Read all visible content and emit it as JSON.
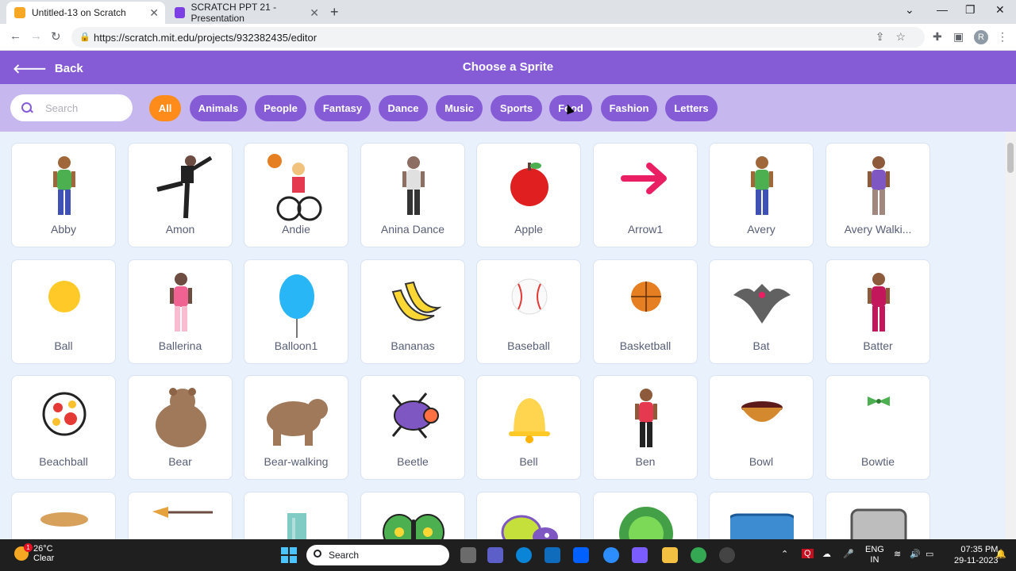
{
  "browser": {
    "tabs": [
      {
        "title": "Untitled-13 on Scratch",
        "active": true
      },
      {
        "title": "SCRATCH PPT 21 - Presentation",
        "active": false
      }
    ],
    "url": "https://scratch.mit.edu/projects/932382435/editor",
    "profile_initial": "R"
  },
  "header": {
    "back_label": "Back",
    "title": "Choose a Sprite"
  },
  "search": {
    "placeholder": "Search"
  },
  "filters": [
    {
      "label": "All",
      "active": true
    },
    {
      "label": "Animals",
      "active": false
    },
    {
      "label": "People",
      "active": false
    },
    {
      "label": "Fantasy",
      "active": false
    },
    {
      "label": "Dance",
      "active": false
    },
    {
      "label": "Music",
      "active": false
    },
    {
      "label": "Sports",
      "active": false
    },
    {
      "label": "Food",
      "active": false
    },
    {
      "label": "Fashion",
      "active": false
    },
    {
      "label": "Letters",
      "active": false
    }
  ],
  "sprites": [
    {
      "name": "Abby",
      "icon": "girl-standing"
    },
    {
      "name": "Amon",
      "icon": "man-balancing"
    },
    {
      "name": "Andie",
      "icon": "wheelchair-basketball"
    },
    {
      "name": "Anina Dance",
      "icon": "woman-dancing"
    },
    {
      "name": "Apple",
      "icon": "apple"
    },
    {
      "name": "Arrow1",
      "icon": "arrow"
    },
    {
      "name": "Avery",
      "icon": "girl-standing"
    },
    {
      "name": "Avery Walki...",
      "icon": "girl-walking"
    },
    {
      "name": "Ball",
      "icon": "ball"
    },
    {
      "name": "Ballerina",
      "icon": "ballerina"
    },
    {
      "name": "Balloon1",
      "icon": "balloon"
    },
    {
      "name": "Bananas",
      "icon": "bananas"
    },
    {
      "name": "Baseball",
      "icon": "baseball"
    },
    {
      "name": "Basketball",
      "icon": "basketball"
    },
    {
      "name": "Bat",
      "icon": "bat"
    },
    {
      "name": "Batter",
      "icon": "batter"
    },
    {
      "name": "Beachball",
      "icon": "beachball"
    },
    {
      "name": "Bear",
      "icon": "bear"
    },
    {
      "name": "Bear-walking",
      "icon": "bear-walking"
    },
    {
      "name": "Beetle",
      "icon": "beetle"
    },
    {
      "name": "Bell",
      "icon": "bell"
    },
    {
      "name": "Ben",
      "icon": "boy-running"
    },
    {
      "name": "Bowl",
      "icon": "bowl"
    },
    {
      "name": "Bowtie",
      "icon": "bowtie"
    },
    {
      "name": "",
      "icon": "bread"
    },
    {
      "name": "",
      "icon": "broom"
    },
    {
      "name": "",
      "icon": "building"
    },
    {
      "name": "",
      "icon": "butterfly"
    },
    {
      "name": "",
      "icon": "butterfly-creature"
    },
    {
      "name": "",
      "icon": "button-green"
    },
    {
      "name": "",
      "icon": "button-blue"
    },
    {
      "name": "",
      "icon": "button-gray"
    }
  ],
  "taskbar": {
    "weather_temp": "26°C",
    "weather_desc": "Clear",
    "weather_badge": "1",
    "search_label": "Search",
    "lang": "ENG",
    "region": "IN",
    "time": "07:35 PM",
    "date": "29-11-2023"
  },
  "colors": {
    "scratch_purple": "#855cd6",
    "filter_bg": "#c6b7ef",
    "active_chip": "#ff8c1a",
    "grid_bg": "#e9f1fc"
  }
}
